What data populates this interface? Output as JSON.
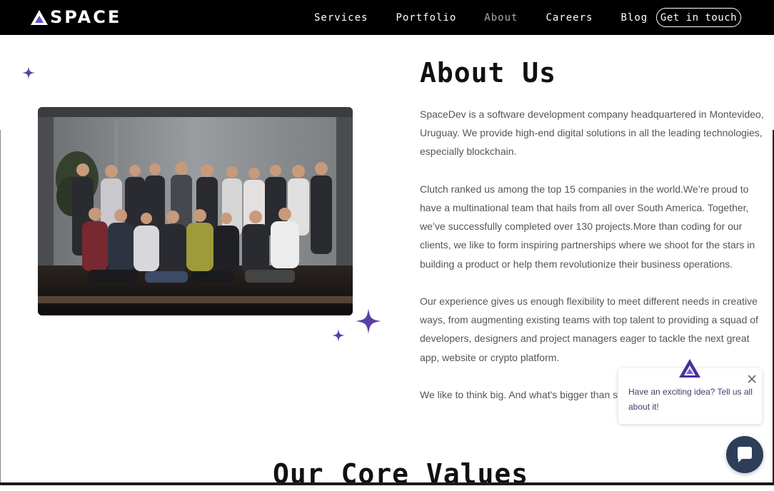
{
  "brand": {
    "logo_text": "SPACE",
    "accent": "#5b3fa6"
  },
  "nav": {
    "links": [
      {
        "label": "Services"
      },
      {
        "label": "Portfolio"
      },
      {
        "label": "About"
      },
      {
        "label": "Careers"
      },
      {
        "label": "Blog"
      }
    ],
    "active": "About",
    "cta": "Get in touch"
  },
  "about": {
    "title": "About Us",
    "paragraphs": [
      "SpaceDev is a software development company headquartered in Montevideo, Uruguay. We provide high-end digital solutions in all the leading technologies, especially blockchain.",
      "Clutch ranked us among the top 15 companies in the world.We’re proud to have a multinational team that hails from all over South America. Together, we’ve successfully completed over 130 projects.More than coding for our clients, we like to form inspiring partnerships where we shoot for the stars in building a product or help them revolutionize their business operations.",
      "Our experience gives us enough flexibility to meet different needs in creative ways, from augmenting existing teams with top talent to providing a squad of developers, designers and project managers eager to tackle the next great app, website or crypto platform.",
      "We like to think big. And what's bigger than sp"
    ]
  },
  "core_values": {
    "title": "Our Core Values"
  },
  "chat": {
    "message": "Have an exciting idea? Tell us all about it!"
  },
  "icons": {
    "logo": "triangle-logo-icon",
    "stars": "sparkle-star-icon",
    "close": "close-icon",
    "chat": "chat-bubble-icon"
  }
}
